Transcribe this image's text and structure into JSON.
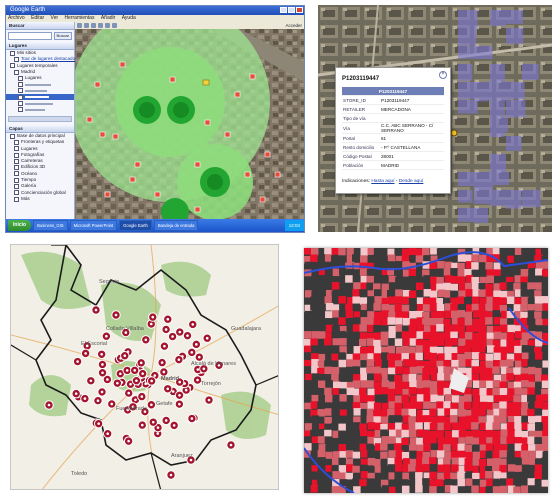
{
  "panel1": {
    "window_title": "Google Earth",
    "menu": [
      "Archivo",
      "Editar",
      "Ver",
      "Herramientas",
      "Añadir",
      "Ayuda"
    ],
    "search": {
      "header": "Buscar",
      "button": "Buscar",
      "input_value": ""
    },
    "places_header": "Lugares",
    "places_items": [
      "Mis sitios",
      "Tour de lugares destacados",
      "Lugares temporales",
      "Madrid",
      "Lugares"
    ],
    "layers_header": "Capas",
    "layers_items": [
      "Base de datos principal",
      "Fronteras y etiquetas",
      "Lugares",
      "Fotografías",
      "Carreteras",
      "Edificios 3D",
      "Océano",
      "Tiempo",
      "Galería",
      "Concienciación global",
      "Más"
    ],
    "toolbar_link": "Acceder",
    "taskbar": {
      "start": "Inicio",
      "tasks": [
        "Business_GIS",
        "Microsoft PowerPoint",
        "Google Earth",
        "Bandeja de entrada"
      ],
      "clock": "12:04"
    },
    "colors": {
      "buffer": "#7fdc6f",
      "buffer_core": "#1fa82a",
      "store_marker": "#e84d3c"
    }
  },
  "panel2": {
    "popup": {
      "title": "P1203119447",
      "header_row": "P1203119447",
      "rows": [
        {
          "k": "STORE_ID",
          "v": "P1203119447"
        },
        {
          "k": "RETAILER",
          "v": "MERCADONA"
        },
        {
          "k": "Tipo de vía",
          "v": ""
        },
        {
          "k": "Vía",
          "v": "C.C. ABC SERRANO - C/ SERRANO"
        },
        {
          "k": "Portal",
          "v": "61"
        },
        {
          "k": "Resto domicilio",
          "v": "- P.º CASTELLANA"
        },
        {
          "k": "Código Postal",
          "v": "28001"
        },
        {
          "k": "Población",
          "v": "MADRID"
        }
      ],
      "directions_label": "Indicaciones:",
      "link_to": "Hasta aquí",
      "link_from": "Desde aquí"
    },
    "colors": {
      "footprint": "#7d78d6"
    }
  },
  "panel3": {
    "place_labels": [
      "Segovia",
      "Guadalajara",
      "Madrid",
      "Alcalá de Henares",
      "Fuenlabrada",
      "Getafe",
      "Aranjuez",
      "Toledo",
      "El Escorial",
      "Collado Villalba",
      "Torrejón"
    ],
    "colors": {
      "boundary": "#1b1b1b",
      "marker": "#a3152f",
      "park": "#a9cf8e"
    }
  },
  "panel4": {
    "colors": {
      "high": "#e8132b",
      "mid": "#d4606a",
      "low": "#f3c6c9",
      "none": "#3a3a3a",
      "boundary": "#2c4ed8"
    }
  }
}
